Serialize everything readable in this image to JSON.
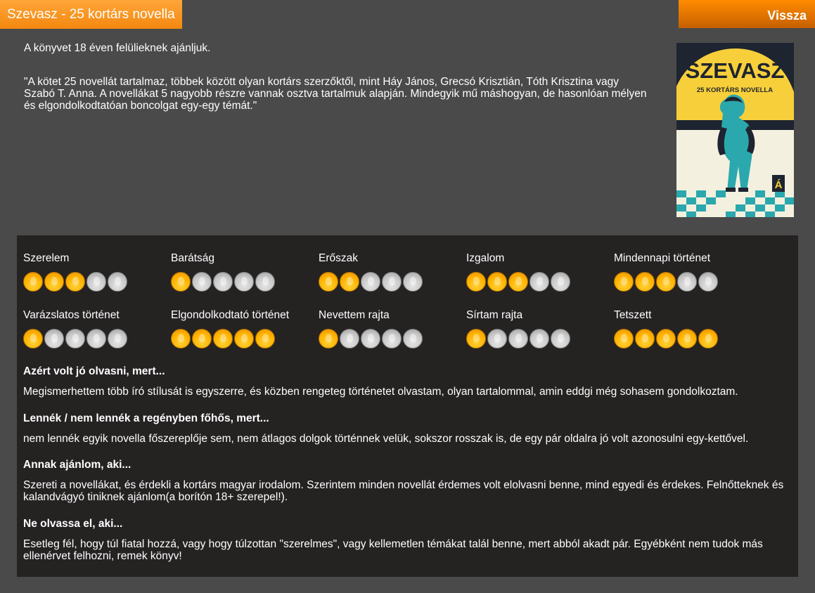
{
  "header": {
    "title": "Szevasz - 25 kortárs novella",
    "back_label": "Vissza"
  },
  "intro": {
    "age_note": "A könyvet 18 éven felülieknek ajánljuk.",
    "description": "\"A kötet 25 novellát tartalmaz, többek között olyan kortárs szerzőktől, mint Háy János, Grecsó Krisztián, Tóth Krisztina vagy Szabó T. Anna. A novellákat 5 nagyobb részre vannak osztva tartalmuk alapján. Mindegyik mű máshogyan, de hasonlóan mélyen és elgondolkodtatóan boncolgat egy-egy témát.\""
  },
  "cover": {
    "title": "SZEVASZ",
    "subtitle": "25 KORTÁRS NOVELLA",
    "publisher_mark": "Á",
    "colors": {
      "sky": "#f7cf3a",
      "ground": "#f3f0df",
      "teal": "#2aa8ad",
      "dark": "#1e2430"
    }
  },
  "ratings": {
    "max": 5,
    "items": [
      {
        "label": "Szerelem",
        "value": 3
      },
      {
        "label": "Barátság",
        "value": 1
      },
      {
        "label": "Erőszak",
        "value": 2
      },
      {
        "label": "Izgalom",
        "value": 3
      },
      {
        "label": "Mindennapi történet",
        "value": 3
      },
      {
        "label": "Varázslatos történet",
        "value": 1
      },
      {
        "label": "Elgondolkodtató történet",
        "value": 5
      },
      {
        "label": "Nevettem rajta",
        "value": 1
      },
      {
        "label": "Sírtam rajta",
        "value": 1
      },
      {
        "label": "Tetszett",
        "value": 5
      }
    ]
  },
  "review": {
    "sections": [
      {
        "heading": "Azért volt jó olvasni, mert...",
        "text": "Megismerhettem több író stílusát is egyszerre, és közben rengeteg történetet olvastam, olyan tartalommal, amin eddgi még sohasem gondolkoztam."
      },
      {
        "heading": "Lennék / nem lennék a regényben főhős, mert...",
        "text": "nem lennék egyik novella főszereplője sem, nem átlagos dolgok történnek velük, sokszor rosszak is, de egy pár oldalra jó volt azonosulni egy-kettővel."
      },
      {
        "heading": "Annak ajánlom, aki...",
        "text": "Szereti a novellákat, és érdekli a kortárs magyar irodalom. Szerintem minden novellát érdemes volt elolvasni benne, mind egyedi és érdekes. Felnőtteknek és kalandvágyó tiniknek ajánlom(a borítón 18+ szerepel!)."
      },
      {
        "heading": "Ne olvassa el, aki...",
        "text": "Esetleg fél, hogy túl fiatal hozzá, vagy hogy túlzottan \"szerelmes\", vagy kellemetlen témákat talál benne, mert abból akadt pár. Egyébként nem tudok más ellenérvet felhozni, remek könyv!"
      }
    ]
  },
  "colors": {
    "accent": "#f7931e",
    "page_bg": "#4a4a4a",
    "panel_bg": "#252222",
    "star_on": "#ffb300",
    "star_off": "#c8c8c8"
  }
}
